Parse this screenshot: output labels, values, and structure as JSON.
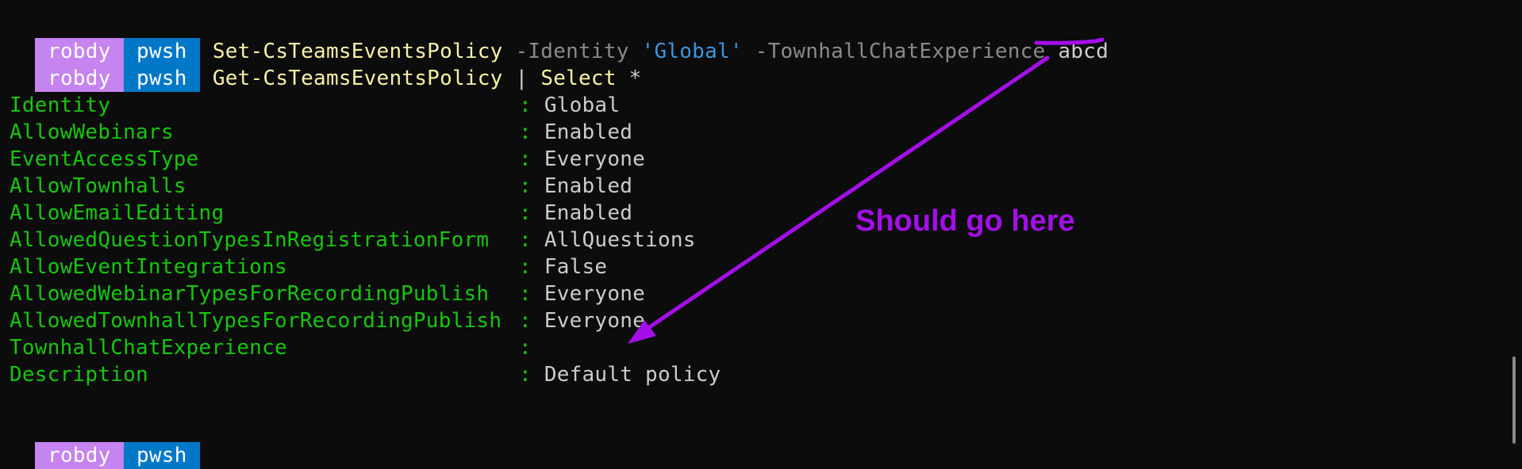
{
  "prompt": {
    "user": "robdy",
    "shell": "pwsh",
    "user_color": "#c584ef",
    "shell_color": "#0078c8"
  },
  "commands": [
    {
      "cmdlet": "Set-CsTeamsEventsPolicy",
      "param1": "-Identity",
      "value1": "'Global'",
      "param2": "-TownhallChatExperience",
      "value2": "abcd"
    },
    {
      "cmdlet": "Get-CsTeamsEventsPolicy",
      "pipe": "|",
      "select": "Select",
      "star": "*"
    }
  ],
  "output": [
    {
      "key": "Identity",
      "value": "Global"
    },
    {
      "key": "AllowWebinars",
      "value": "Enabled"
    },
    {
      "key": "EventAccessType",
      "value": "Everyone"
    },
    {
      "key": "AllowTownhalls",
      "value": "Enabled"
    },
    {
      "key": "AllowEmailEditing",
      "value": "Enabled"
    },
    {
      "key": "AllowedQuestionTypesInRegistrationForm",
      "value": "AllQuestions"
    },
    {
      "key": "AllowEventIntegrations",
      "value": "False"
    },
    {
      "key": "AllowedWebinarTypesForRecordingPublish",
      "value": "Everyone"
    },
    {
      "key": "AllowedTownhallTypesForRecordingPublish",
      "value": "Everyone"
    },
    {
      "key": "TownhallChatExperience",
      "value": ""
    },
    {
      "key": "Description",
      "value": "Default policy"
    }
  ],
  "separator": ":",
  "annotation": {
    "text": "Should go here",
    "color": "#a30fe8"
  }
}
